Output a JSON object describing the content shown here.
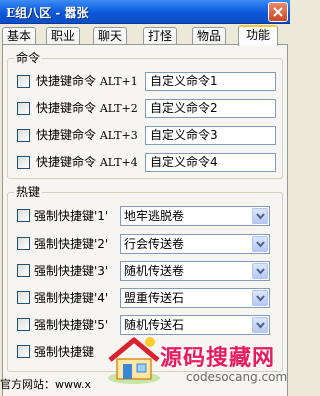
{
  "window": {
    "title": "E组八区 - 嚣张"
  },
  "tabs": [
    {
      "label": "基本"
    },
    {
      "label": "职业"
    },
    {
      "label": "聊天"
    },
    {
      "label": "打怪"
    },
    {
      "label": "物品"
    },
    {
      "label": "功能",
      "active": true
    }
  ],
  "commands": {
    "group_label": "命令",
    "rows": [
      {
        "label": "快捷键命令",
        "hotkey": "ALT+1",
        "value": "自定义命令1",
        "checked": false
      },
      {
        "label": "快捷键命令",
        "hotkey": "ALT+2",
        "value": "自定义命令2",
        "checked": false
      },
      {
        "label": "快捷键命令",
        "hotkey": "ALT+3",
        "value": "自定义命令3",
        "checked": false
      },
      {
        "label": "快捷键命令",
        "hotkey": "ALT+4",
        "value": "自定义命令4",
        "checked": false
      }
    ]
  },
  "hotkeys": {
    "group_label": "热键",
    "rows": [
      {
        "label": "强制快捷键'1'",
        "value": "地牢逃脱卷",
        "checked": false
      },
      {
        "label": "强制快捷键'2'",
        "value": "行会传送卷",
        "checked": false
      },
      {
        "label": "强制快捷键'3'",
        "value": "随机传送卷",
        "checked": false
      },
      {
        "label": "强制快捷键'4'",
        "value": "盟重传送石",
        "checked": false
      },
      {
        "label": "强制快捷键'5'",
        "value": "随机传送石",
        "checked": false
      },
      {
        "label": "强制快捷键",
        "checked": false
      }
    ]
  },
  "footer": {
    "text": "官方网站：www.x"
  },
  "watermark": {
    "title": "源码搜藏网",
    "subtitle": "codesocang.com"
  },
  "colors": {
    "titlebar": "#0a55d6",
    "tab_active_accent": "#ffc83c",
    "watermark": "#e81c5c"
  }
}
